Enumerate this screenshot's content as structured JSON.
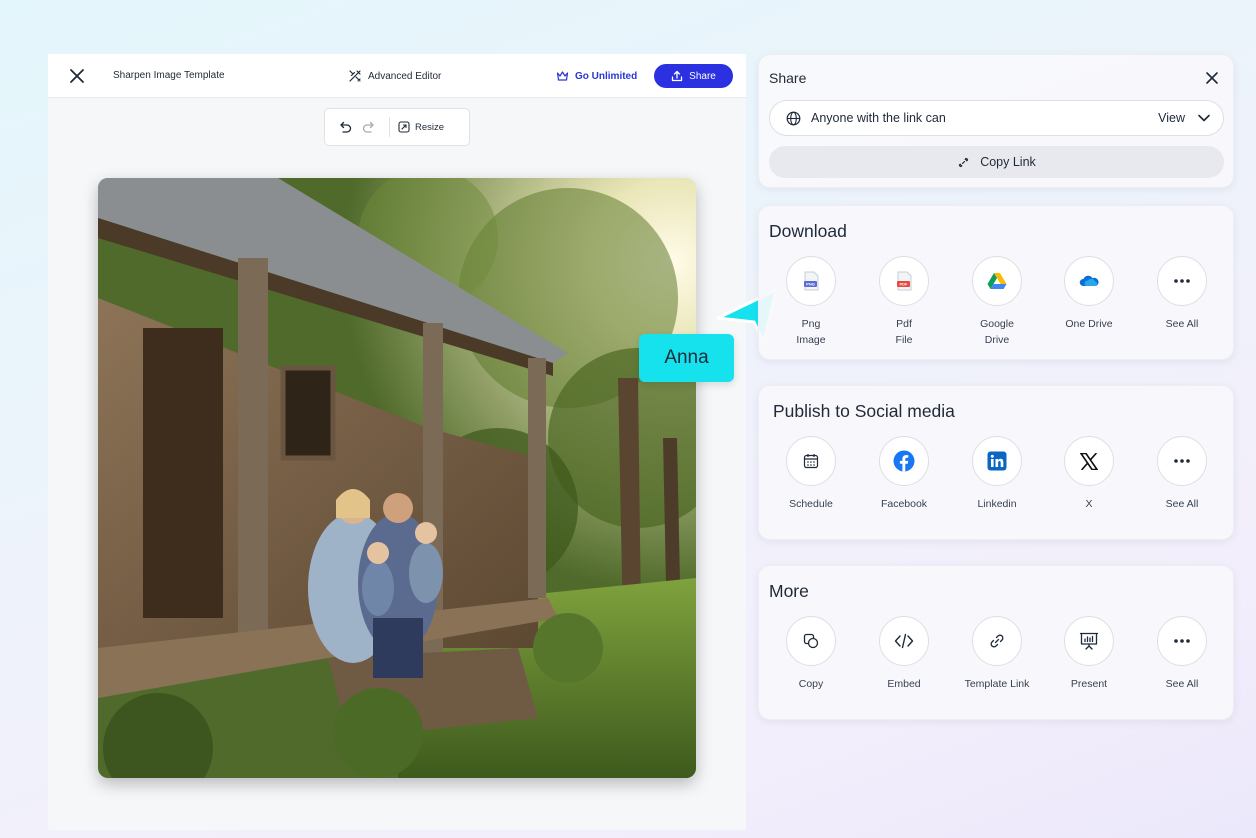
{
  "editor": {
    "doc_title": "Sharpen Image Template",
    "advanced_editor": "Advanced Editor",
    "go_unlimited": "Go Unlimited",
    "share_button": "Share",
    "resize_label": "Resize"
  },
  "cursor": {
    "name": "Anna",
    "color": "#16e2ee"
  },
  "share_panel": {
    "title": "Share",
    "access_text": "Anyone with the link can",
    "access_level": "View",
    "copy_link": "Copy Link"
  },
  "download": {
    "title": "Download",
    "options": [
      {
        "label": "Png\nImage",
        "icon": "png-file-icon"
      },
      {
        "label": "Pdf\nFile",
        "icon": "pdf-file-icon"
      },
      {
        "label": "Google\nDrive",
        "icon": "google-drive-icon"
      },
      {
        "label": "One Drive",
        "icon": "onedrive-icon"
      },
      {
        "label": "See All",
        "icon": "more-dots-icon"
      }
    ]
  },
  "social": {
    "title": "Publish to Social media",
    "options": [
      {
        "label": "Schedule",
        "icon": "calendar-icon"
      },
      {
        "label": "Facebook",
        "icon": "facebook-icon"
      },
      {
        "label": "Linkedin",
        "icon": "linkedin-icon"
      },
      {
        "label": "X",
        "icon": "x-logo-icon"
      },
      {
        "label": "See All",
        "icon": "more-dots-icon"
      }
    ]
  },
  "more": {
    "title": "More",
    "options": [
      {
        "label": "Copy",
        "icon": "copy-icon"
      },
      {
        "label": "Embed",
        "icon": "code-icon"
      },
      {
        "label": "Template Link",
        "icon": "link-icon"
      },
      {
        "label": "Present",
        "icon": "presentation-icon"
      },
      {
        "label": "See All",
        "icon": "more-dots-icon"
      }
    ]
  },
  "colors": {
    "accent": "#2b30e0",
    "link": "#2a35d6",
    "png": "#5b6bd6",
    "pdf": "#e5483d",
    "facebook": "#1877f2",
    "linkedin": "#0a66c2",
    "onedrive": "#0a6fd8"
  }
}
